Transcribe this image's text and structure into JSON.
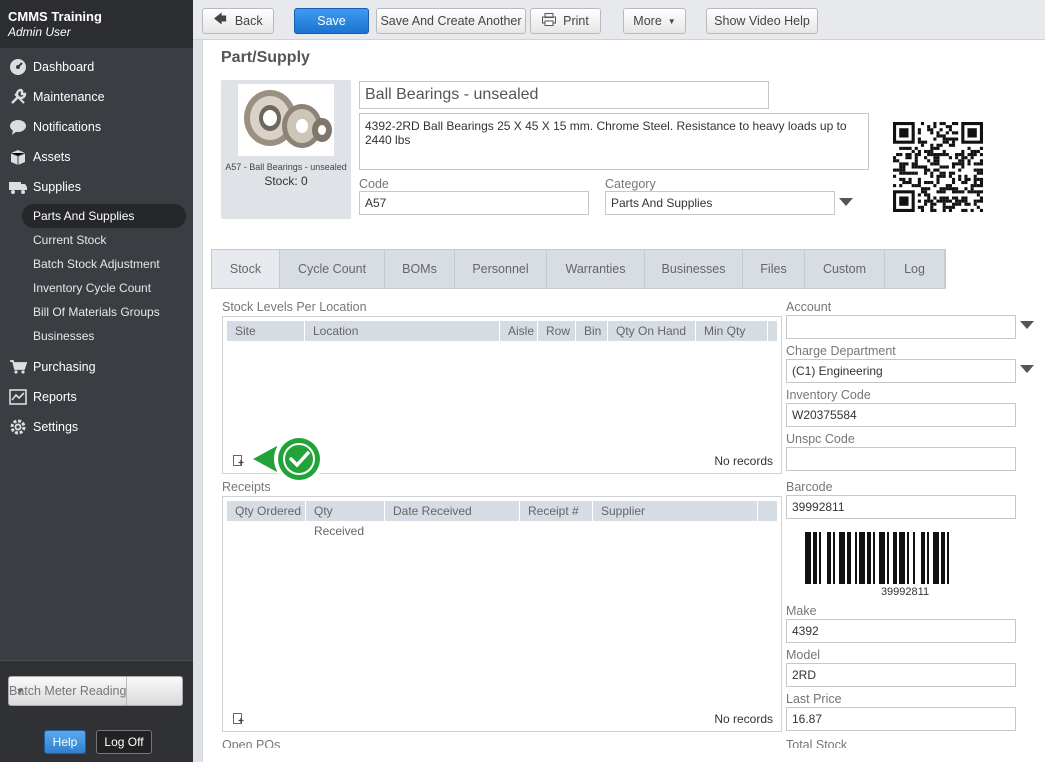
{
  "app": {
    "title": "CMMS Training",
    "user": "Admin User"
  },
  "sidebar": {
    "items": [
      {
        "label": "Dashboard",
        "icon": "dashboard-gauge-icon"
      },
      {
        "label": "Maintenance",
        "icon": "wrench-icon"
      },
      {
        "label": "Notifications",
        "icon": "speech-bubble-icon"
      },
      {
        "label": "Assets",
        "icon": "box-icon"
      },
      {
        "label": "Supplies",
        "icon": "truck-icon"
      }
    ],
    "supplies_sub": [
      "Parts And Supplies",
      "Current Stock",
      "Batch Stock Adjustment",
      "Inventory Cycle Count",
      "Bill Of Materials Groups",
      "Businesses"
    ],
    "items_after": [
      {
        "label": "Purchasing",
        "icon": "cart-icon"
      },
      {
        "label": "Reports",
        "icon": "chart-icon"
      },
      {
        "label": "Settings",
        "icon": "gear-icon"
      }
    ],
    "batch_meter": "Batch Meter Reading",
    "help": "Help",
    "logoff": "Log Off"
  },
  "toolbar": {
    "back": "Back",
    "save": "Save",
    "save_another": "Save And Create Another",
    "print": "Print",
    "more": "More",
    "video_help": "Show Video Help"
  },
  "page": {
    "title": "Part/Supply",
    "name": "Ball Bearings - unsealed",
    "description": "4392-2RD Ball Bearings 25 X 45 X 15 mm. Chrome Steel. Resistance to heavy loads up to 2440 lbs",
    "image_caption": "A57 - Ball Bearings - unsealed",
    "stock_caption": "Stock: 0",
    "code_label": "Code",
    "code": "A57",
    "category_label": "Category",
    "category": "Parts And Supplies"
  },
  "tabs": [
    "Stock",
    "Cycle Count",
    "BOMs",
    "Personnel",
    "Warranties",
    "Businesses",
    "Files",
    "Custom",
    "Log"
  ],
  "stock_levels": {
    "title": "Stock Levels Per Location",
    "columns": [
      "Site",
      "Location",
      "Aisle",
      "Row",
      "Bin",
      "Qty On Hand",
      "Min Qty"
    ],
    "empty": "No records"
  },
  "receipts": {
    "title": "Receipts",
    "columns": [
      "Qty Ordered",
      "Qty Received",
      "Date Received",
      "Receipt #",
      "Supplier"
    ],
    "empty": "No records"
  },
  "open_pos_label": "Open POs",
  "right": {
    "account_label": "Account",
    "account": "",
    "charge_label": "Charge Department",
    "charge": "(C1) Engineering",
    "inv_code_label": "Inventory Code",
    "inv_code": "W20375584",
    "unspc_label": "Unspc Code",
    "unspc": "",
    "barcode_label": "Barcode",
    "barcode": "39992811",
    "barcode_text": "39992811",
    "make_label": "Make",
    "make": "4392",
    "model_label": "Model",
    "model": "2RD",
    "last_price_label": "Last Price",
    "last_price": "16.87",
    "total_stock_label": "Total Stock"
  },
  "colors": {
    "accent": "#1b74d1",
    "sidebar": "#3a3d41",
    "check": "#22a33a"
  }
}
